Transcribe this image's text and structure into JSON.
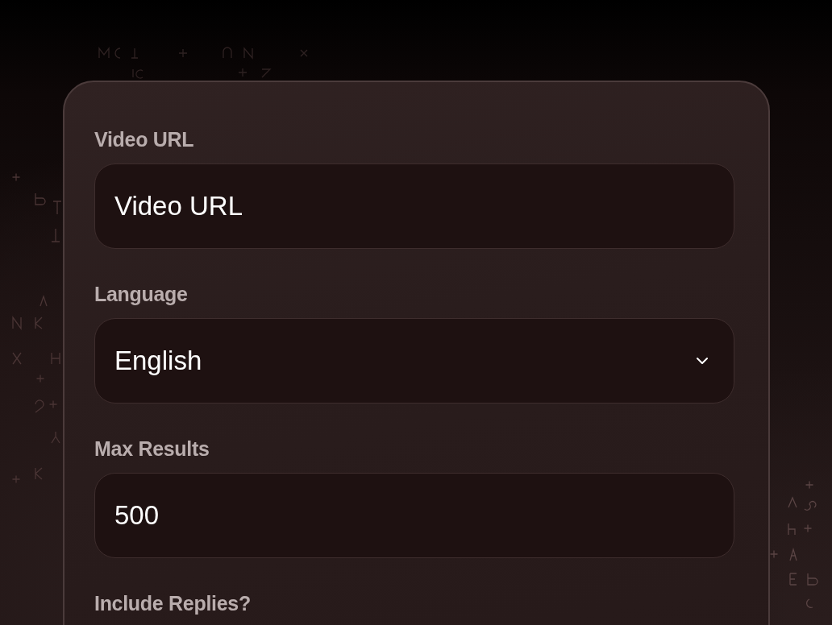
{
  "form": {
    "fields": [
      {
        "kind": "input",
        "label": "Video URL",
        "placeholder": "Video URL"
      },
      {
        "kind": "select",
        "label": "Language",
        "value": "English"
      },
      {
        "kind": "input",
        "label": "Max Results",
        "value": "500"
      }
    ],
    "partial_field": {
      "label": "Include Replies?"
    }
  }
}
